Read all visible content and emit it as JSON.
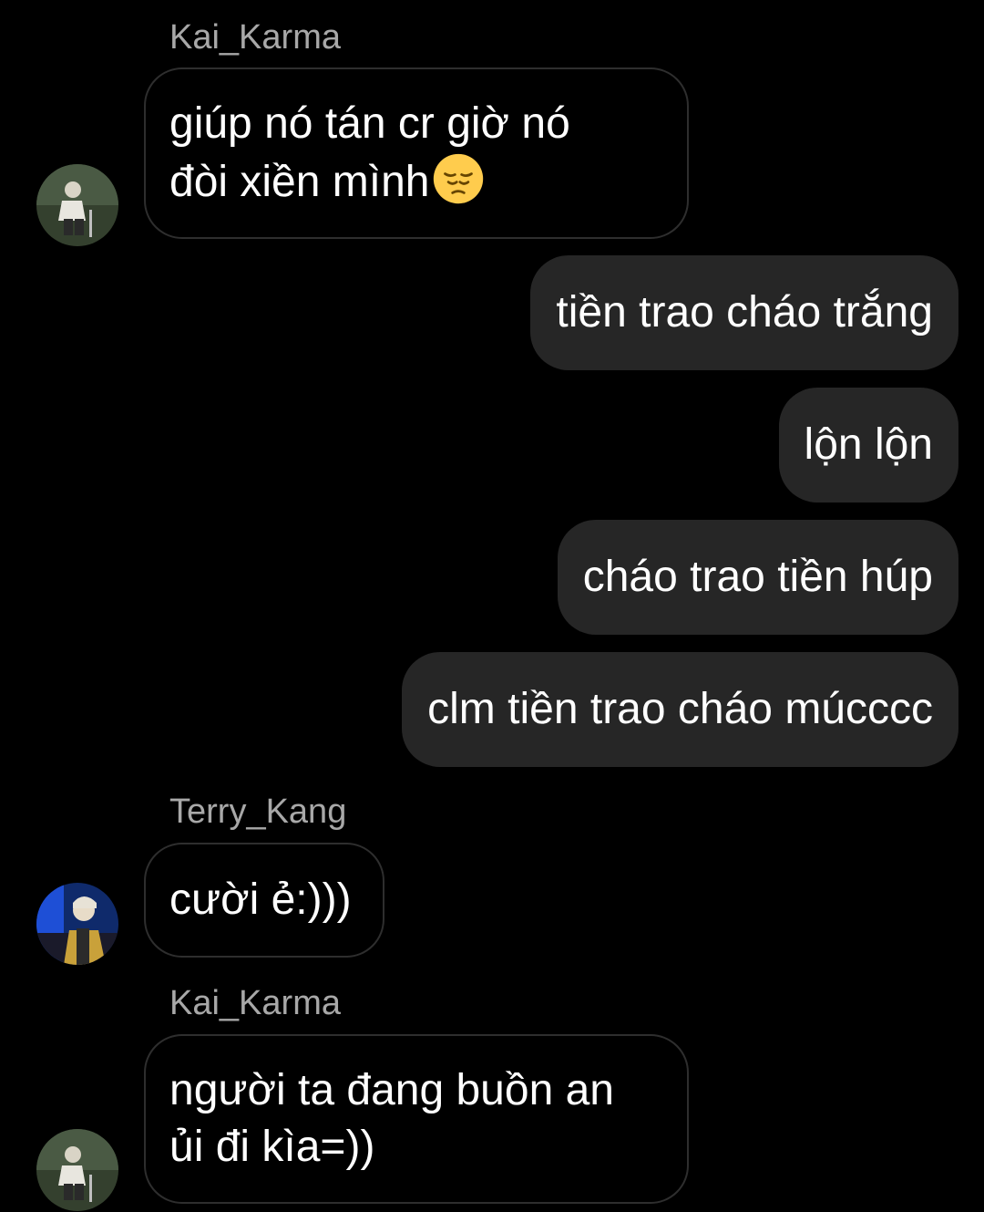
{
  "messages": [
    {
      "sender": "Kai_Karma",
      "text_line1": "giúp nó tán cr giờ nó",
      "text_line2": "đòi xiền mình",
      "emoji": "pensive-face-icon"
    },
    {
      "text": "tiền trao cháo trắng"
    },
    {
      "text": "lộn lộn"
    },
    {
      "text": "cháo trao tiền húp"
    },
    {
      "text": "clm tiền trao cháo múcccc"
    },
    {
      "sender": "Terry_Kang",
      "text": "cười ẻ:)))"
    },
    {
      "sender": "Kai_Karma",
      "text_line1": "người ta đang buồn an",
      "text_line2": "ủi đi kìa=))"
    }
  ],
  "colors": {
    "background": "#000000",
    "outgoing_bubble": "#262626",
    "incoming_border": "#2e2e2e",
    "sender_name": "#a8a8a8",
    "text": "#ffffff"
  }
}
